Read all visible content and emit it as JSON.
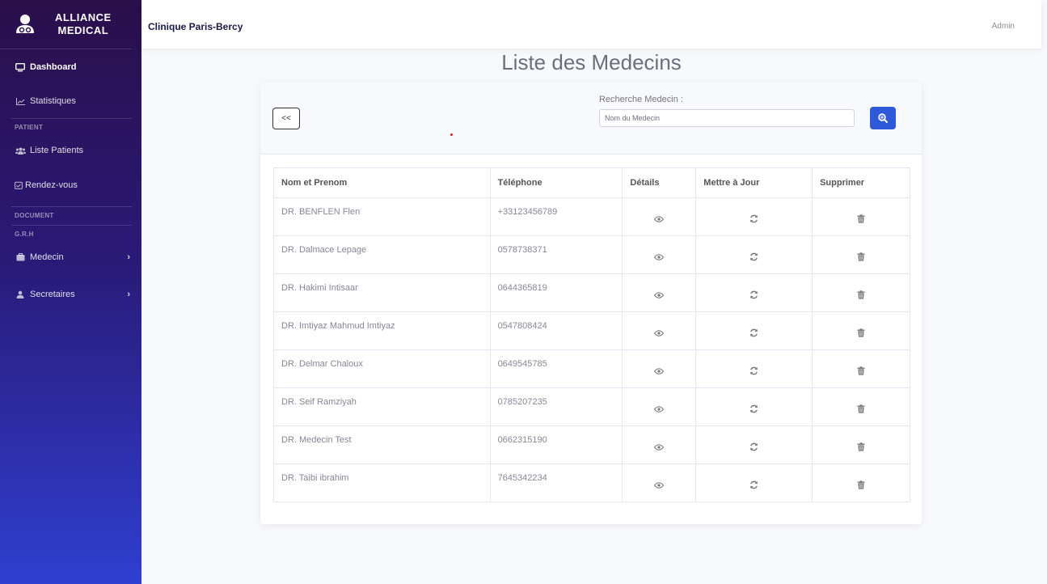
{
  "brand": {
    "line1": "ALLIANCE",
    "line2": "MEDICAL"
  },
  "sidebar": {
    "items": [
      {
        "label": "Dashboard",
        "icon": "monitor-icon"
      },
      {
        "label": "Statistiques",
        "icon": "chart-line-icon"
      },
      {
        "label": "Liste Patients",
        "icon": "users-icon"
      },
      {
        "label": "Rendez-vous",
        "icon": "calendar-check-icon"
      },
      {
        "label": "Medecin",
        "icon": "id-badge-icon"
      },
      {
        "label": "Secretaires",
        "icon": "user-icon"
      }
    ],
    "headings": {
      "patient": "PATIENT",
      "document": "DOCUMENT",
      "grh": "G.R.H"
    },
    "chevron": "›"
  },
  "topbar": {
    "clinic": "Clinique Paris-Bercy",
    "user": "Admin"
  },
  "page": {
    "title": "Liste des Medecins"
  },
  "search": {
    "back_label": "<<",
    "label": "Recherche Medecin :",
    "placeholder": "Nom du Medecin"
  },
  "table": {
    "headers": [
      "Nom et Prenom",
      "Téléphone",
      "Détails",
      "Mettre à Jour",
      "Supprimer"
    ],
    "rows": [
      {
        "name": "DR. BENFLEN Flen",
        "phone": "+33123456789"
      },
      {
        "name": "DR. Dalmace Lepage",
        "phone": "0578738371"
      },
      {
        "name": "DR. Hakimi Intisaar",
        "phone": "0644365819"
      },
      {
        "name": "DR. Imtiyaz Mahmud Imtiyaz",
        "phone": "0547808424"
      },
      {
        "name": "DR. Delmar Chaloux",
        "phone": "0649545785"
      },
      {
        "name": "DR. Seif Ramziyah",
        "phone": "0785207235"
      },
      {
        "name": "DR. Medecin Test",
        "phone": "0662315190"
      },
      {
        "name": "DR. Taibi ibrahim",
        "phone": "7645342234"
      }
    ]
  },
  "colors": {
    "accent": "#2e59d9",
    "sidebar_top": "#2a0f4a",
    "sidebar_bottom": "#2f3fd0"
  }
}
